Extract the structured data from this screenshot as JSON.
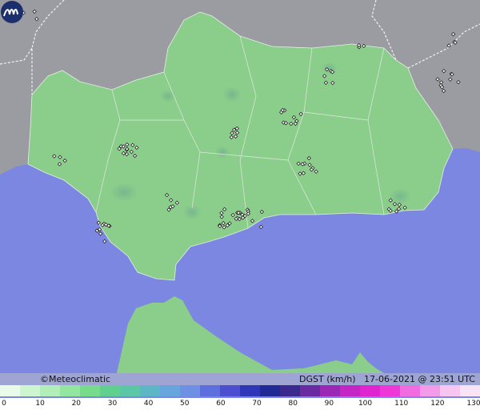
{
  "brand": "©Meteoclimatic",
  "caption": {
    "variable": "DGST (km/h)",
    "date": "17-06-2021",
    "at": "@",
    "time": "23:51 UTC"
  },
  "legend": {
    "ticks": [
      "0",
      "10",
      "20",
      "30",
      "40",
      "50",
      "60",
      "70",
      "80",
      "90",
      "100",
      "110",
      "120",
      "130"
    ],
    "colors": [
      "#e9fbe9",
      "#cdf5cf",
      "#b2efb8",
      "#92e6a0",
      "#76dc8c",
      "#5fd08e",
      "#5cc7a6",
      "#5cb6c6",
      "#67a6dc",
      "#6d90e4",
      "#5d6fdc",
      "#4b4fd0",
      "#2e37b8",
      "#1f2a94",
      "#3b2a8e",
      "#6a2aa0",
      "#9a28b4",
      "#c425c4",
      "#e024d0",
      "#ee38d8",
      "#f06ce0",
      "#f39ae8",
      "#f6c6f0",
      "#f9e4f6"
    ]
  },
  "map": {
    "sea_color": "#7b87e0",
    "land_color": "#8bce8b",
    "outside_color": "#9a9a9e",
    "station_count": 180
  }
}
